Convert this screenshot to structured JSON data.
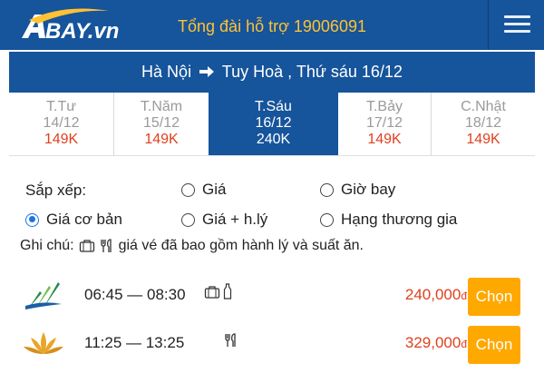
{
  "header": {
    "logo_text": "BAY.vn",
    "hotline": "Tổng đài hỗ trợ 19006091",
    "menu_icon": "hamburger-icon"
  },
  "route": {
    "origin": "Hà Nội",
    "destination": "Tuy Hoà , Thứ sáu 16/12"
  },
  "dates": [
    {
      "day": "T.Tư",
      "date": "14/12",
      "price": "149K",
      "active": false
    },
    {
      "day": "T.Năm",
      "date": "15/12",
      "price": "149K",
      "active": false
    },
    {
      "day": "T.Sáu",
      "date": "16/12",
      "price": "240K",
      "active": true
    },
    {
      "day": "T.Bảy",
      "date": "17/12",
      "price": "149K",
      "active": false
    },
    {
      "day": "C.Nhật",
      "date": "18/12",
      "price": "149K",
      "active": false
    }
  ],
  "sort": {
    "label": "Sắp xếp:",
    "options": [
      {
        "label": "Giá",
        "selected": false
      },
      {
        "label": "Giờ bay",
        "selected": false
      },
      {
        "label": "Giá cơ bản",
        "selected": true
      },
      {
        "label": "Giá + h.lý",
        "selected": false
      },
      {
        "label": "Hạng thương gia",
        "selected": false
      }
    ]
  },
  "note": {
    "prefix": "Ghi chú:",
    "text": "giá vé đã bao gồm hành lý và suất ăn."
  },
  "flights": [
    {
      "airline_logo": "bamboo-airways-logo",
      "time": "06:45 — 08:30",
      "amenities": [
        "luggage-icon",
        "bottle-icon"
      ],
      "price": "240,000",
      "currency": "đ",
      "button": "Chọn"
    },
    {
      "airline_logo": "vietnam-airlines-logo",
      "time": "11:25 — 13:25",
      "amenities": [
        "meal-icon"
      ],
      "price": "329,000",
      "currency": "đ",
      "button": "Chọn"
    }
  ],
  "colors": {
    "brand_blue": "#16549b",
    "hotline_yellow": "#ffc233",
    "price_red": "#e0401e",
    "button_orange": "#ffa800",
    "radio_blue": "#1a73e8"
  }
}
